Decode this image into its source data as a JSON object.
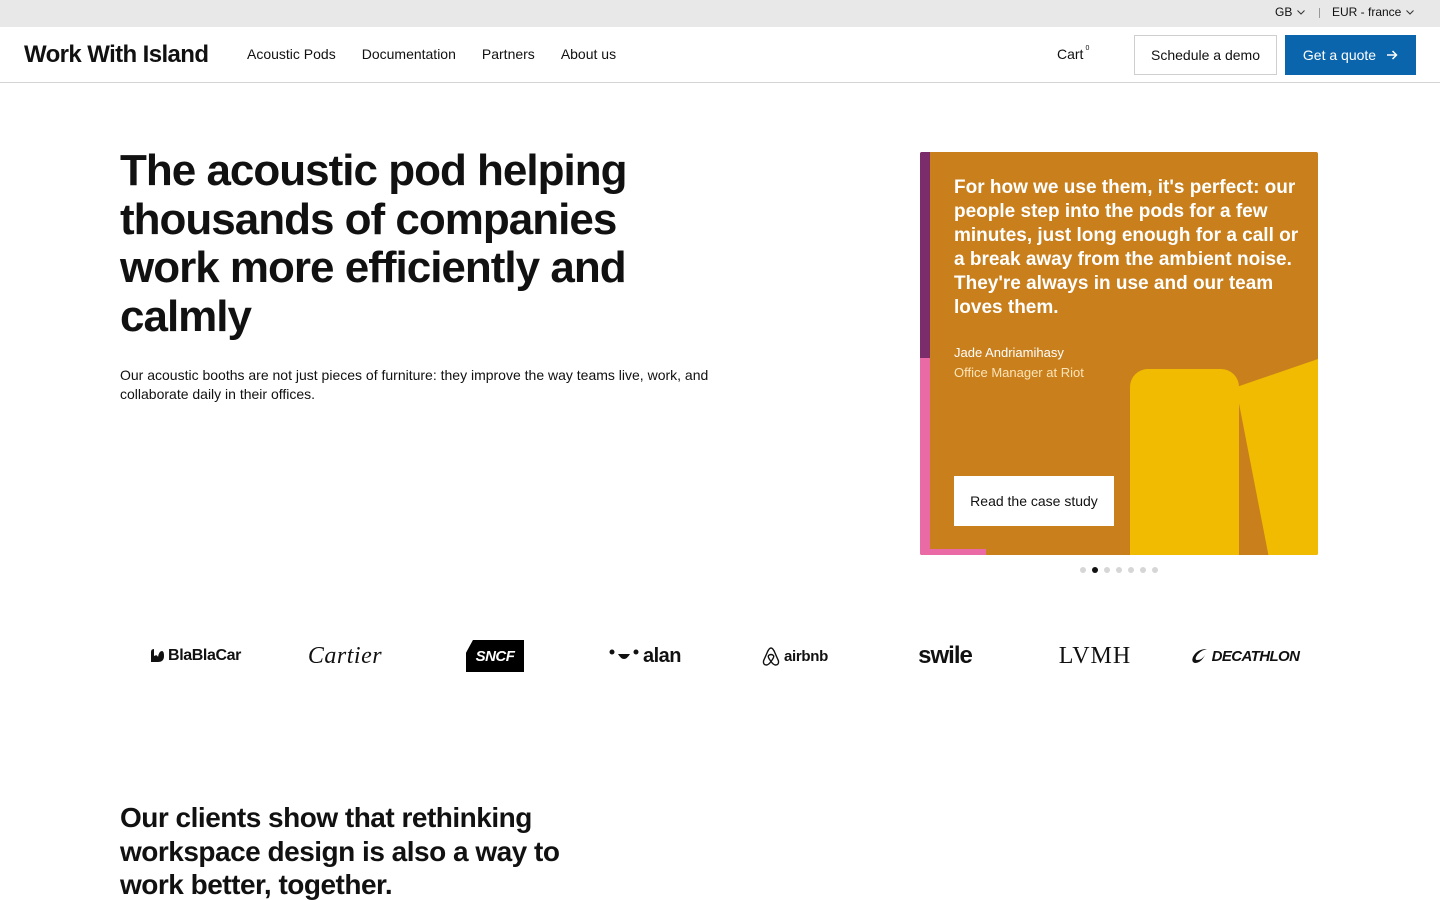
{
  "utility_bar": {
    "region": "GB",
    "currency": "EUR - france"
  },
  "header": {
    "logo": "Work With Island",
    "nav": [
      "Acoustic Pods",
      "Documentation",
      "Partners",
      "About us"
    ],
    "cart_label": "Cart",
    "cart_count": "0",
    "schedule_demo": "Schedule a demo",
    "get_quote": "Get a quote"
  },
  "hero": {
    "title": "The acoustic pod helping thousands of companies work more efficiently and calmly",
    "subtitle": "Our acoustic booths are not just pieces of furniture: they improve the way teams live, work, and collaborate daily in their offices."
  },
  "testimonial": {
    "quote": "For how we use them, it's perfect: our people step into the pods for a few minutes, just long enough for a call or a break away from the ambient noise. They're always in use and our team loves them.",
    "author": "Jade Andriamihasy",
    "role": "Office Manager at Riot",
    "cta": "Read the case study",
    "slide_count": 7,
    "active_slide": 2,
    "colors": {
      "background": "#c87f1c",
      "pod": "#f0bb00",
      "stripe_top": "#7b2d6b",
      "stripe_bottom": "#e96aa5"
    }
  },
  "client_logos": {
    "blablacar": "BlaBlaCar",
    "cartier": "Cartier",
    "sncf": "SNCF",
    "alan": "alan",
    "airbnb": "airbnb",
    "swile": "swile",
    "lvmh": "LVMH",
    "decathlon": "DECATHLON"
  },
  "section": {
    "title": "Our clients show that rethinking workspace design is also a way to work better, together."
  },
  "colors": {
    "accent": "#0a65ad",
    "utility_bar": "#e8e8e8"
  }
}
